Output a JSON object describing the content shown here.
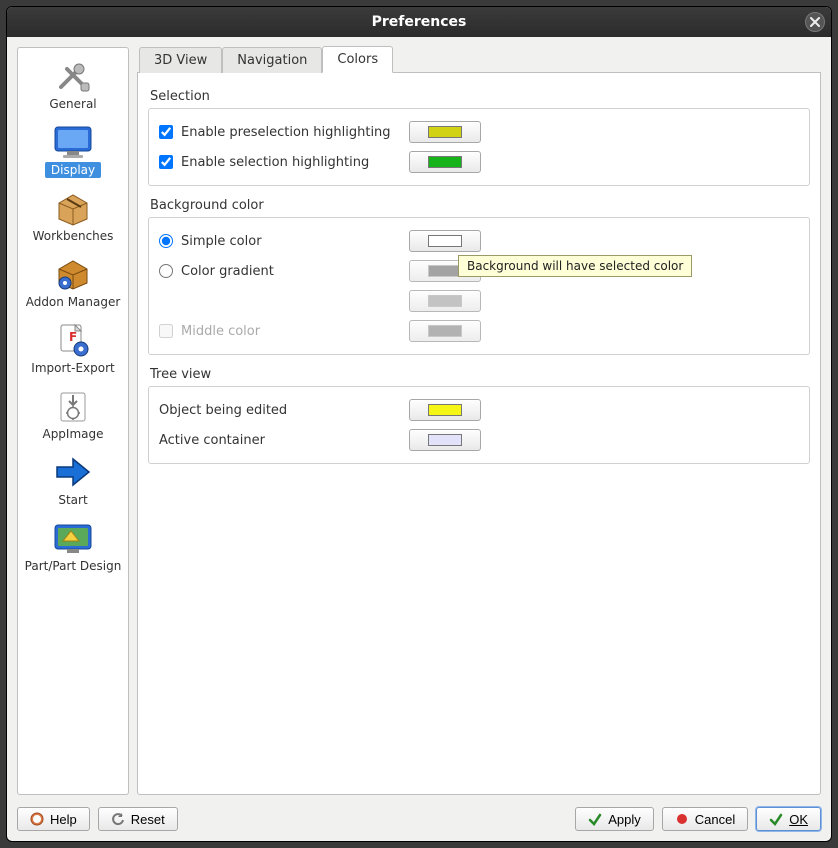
{
  "window": {
    "title": "Preferences"
  },
  "sidebar": {
    "items": [
      {
        "label": "General"
      },
      {
        "label": "Display"
      },
      {
        "label": "Workbenches"
      },
      {
        "label": "Addon Manager"
      },
      {
        "label": "Import-Export"
      },
      {
        "label": "AppImage"
      },
      {
        "label": "Start"
      },
      {
        "label": "Part/Part Design"
      }
    ],
    "selected_index": 1
  },
  "tabs": {
    "items": [
      {
        "label": "3D View"
      },
      {
        "label": "Navigation"
      },
      {
        "label": "Colors"
      }
    ],
    "active_index": 2
  },
  "sections": {
    "selection": {
      "title": "Selection",
      "preselection_label": "Enable preselection highlighting",
      "preselection_checked": true,
      "preselection_color": "#d2d215",
      "selection_label": "Enable selection highlighting",
      "selection_checked": true,
      "selection_color": "#17b31a"
    },
    "background": {
      "title": "Background color",
      "simple_label": "Simple color",
      "simple_selected": true,
      "simple_color": "#ffffff",
      "gradient_label": "Color gradient",
      "gradient_selected": false,
      "gradient_color_top": "#8d8d8d",
      "gradient_color_bottom": "#b5b5b5",
      "middle_label": "Middle color",
      "middle_checked": false,
      "middle_color": "#a0a0a0",
      "tooltip": "Background will have selected color"
    },
    "treeview": {
      "title": "Tree view",
      "object_edited_label": "Object being edited",
      "object_edited_color": "#f5f516",
      "active_container_label": "Active container",
      "active_container_color": "#e2e2fa"
    }
  },
  "footer": {
    "help": "Help",
    "reset": "Reset",
    "apply": "Apply",
    "cancel": "Cancel",
    "ok": "OK"
  }
}
